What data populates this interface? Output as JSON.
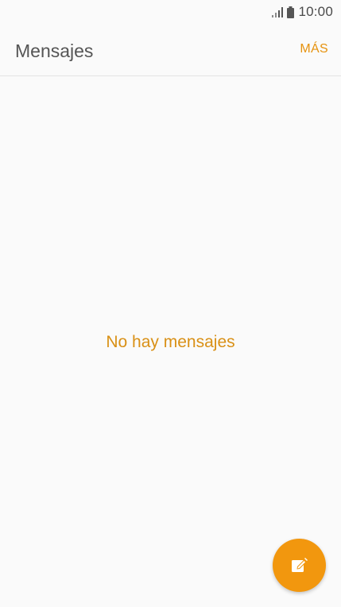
{
  "status_bar": {
    "time": "10:00",
    "icons": [
      "signal-icon",
      "battery-icon"
    ]
  },
  "app_bar": {
    "title": "Mensajes",
    "more_label": "MÁS"
  },
  "empty_state": {
    "message": "No hay mensajes"
  },
  "fab": {
    "icon": "compose-icon"
  },
  "colors": {
    "accent": "#f2970e",
    "accent_text": "#e6920e",
    "background": "#fafafa",
    "title_text": "#555555"
  }
}
